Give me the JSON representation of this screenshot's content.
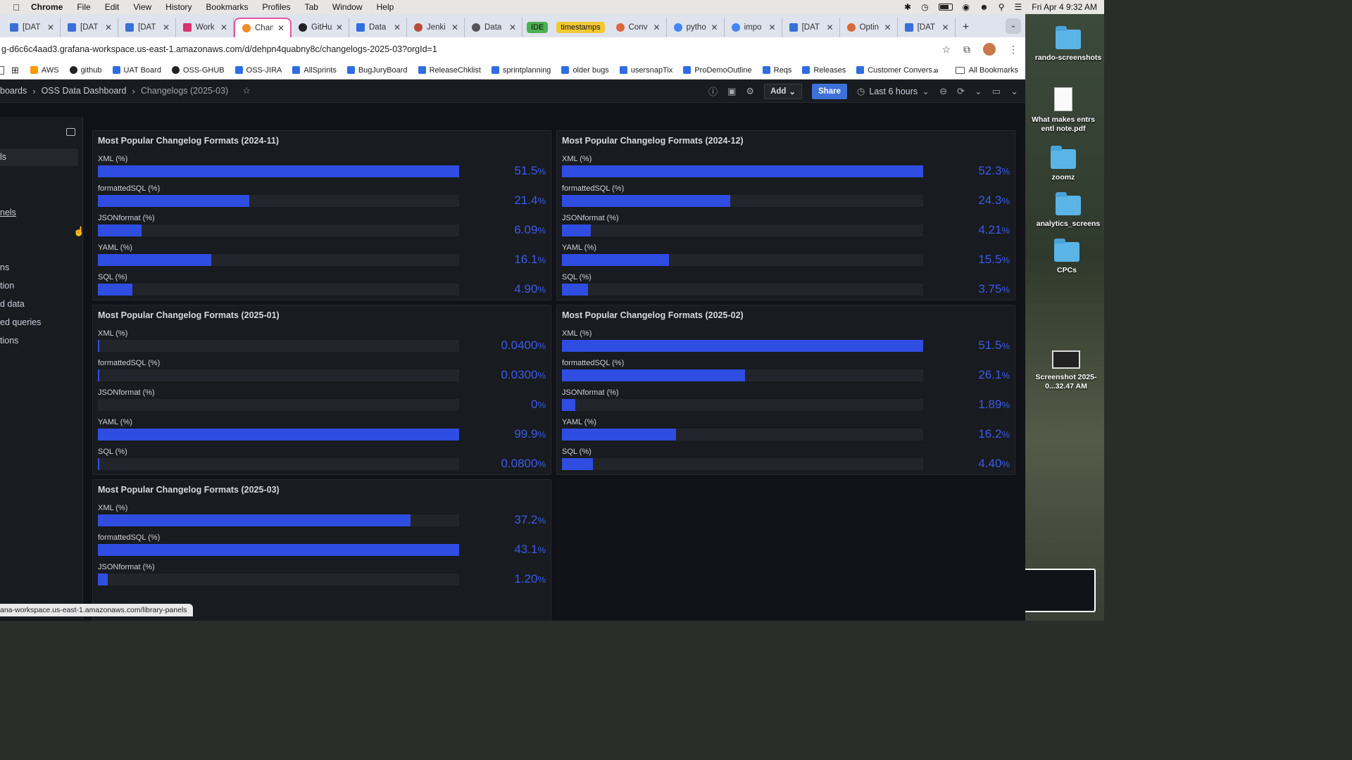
{
  "menubar": {
    "app": "Chrome",
    "items": [
      "File",
      "Edit",
      "View",
      "History",
      "Bookmarks",
      "Profiles",
      "Tab",
      "Window",
      "Help"
    ],
    "clock": "Fri Apr 4  9:32 AM"
  },
  "tabs": [
    {
      "label": "[DAT",
      "color": "#3b6fd8"
    },
    {
      "label": "[DAT",
      "color": "#3b6fd8"
    },
    {
      "label": "[DAT",
      "color": "#3b6fd8"
    },
    {
      "label": "Work",
      "color": "#d6336c"
    },
    {
      "label": "Chan",
      "color": "#f08c2a",
      "active": true
    },
    {
      "label": "GitHu",
      "color": "#222222"
    },
    {
      "label": "Data",
      "color": "#2f6de1"
    },
    {
      "label": "Jenki",
      "color": "#b84a3c"
    },
    {
      "label": "Data",
      "color": "#555555"
    }
  ],
  "tab_pills": [
    {
      "label": "IDE",
      "bg": "#4caf50"
    },
    {
      "label": "timestamps",
      "bg": "#f2c832"
    }
  ],
  "tabs_after": [
    {
      "label": "Conv",
      "color": "#d9693a"
    },
    {
      "label": "pytho",
      "color": "#4285f4"
    },
    {
      "label": "impo",
      "color": "#4285f4"
    },
    {
      "label": "[DAT",
      "color": "#3b6fd8"
    },
    {
      "label": "Optin",
      "color": "#d9693a"
    },
    {
      "label": "[DAT",
      "color": "#3b6fd8"
    }
  ],
  "address": {
    "url": "g-d6c6c4aad3.grafana-workspace.us-east-1.amazonaws.com/d/dehpn4quabny8c/changelogs-2025-03?orgId=1"
  },
  "bookmarks": [
    {
      "label": "AWS",
      "color": "#ff9900"
    },
    {
      "label": "github",
      "color": "#222222"
    },
    {
      "label": "UAT Board",
      "color": "#2f6de1"
    },
    {
      "label": "OSS-GHUB",
      "color": "#222222"
    },
    {
      "label": "OSS-JIRA",
      "color": "#2f6de1"
    },
    {
      "label": "AllSprints",
      "color": "#2f6de1"
    },
    {
      "label": "BugJuryBoard",
      "color": "#2f6de1"
    },
    {
      "label": "ReleaseChklist",
      "color": "#2f6de1"
    },
    {
      "label": "sprintplanning",
      "color": "#2f6de1"
    },
    {
      "label": "older bugs",
      "color": "#2f6de1"
    },
    {
      "label": "usersnapTix",
      "color": "#2f6de1"
    },
    {
      "label": "ProDemoOutline",
      "color": "#2f6de1"
    },
    {
      "label": "Reqs",
      "color": "#2f6de1"
    },
    {
      "label": "Releases",
      "color": "#2f6de1"
    },
    {
      "label": "Customer Convers...",
      "color": "#2f6de1"
    }
  ],
  "all_bookmarks": "All Bookmarks",
  "grafana": {
    "crumb_root": "boards",
    "crumb_dash": "OSS Data Dashboard",
    "crumb_current": "Changelogs (2025-03)",
    "add_label": "Add",
    "share_label": "Share",
    "time_range": "Last 6 hours",
    "sidebar_items": [
      "ls",
      "nels",
      "ns",
      "tion",
      "d data",
      "ed queries",
      "tions"
    ]
  },
  "panels": [
    {
      "title": "Most Popular Changelog Formats (2024-11)",
      "rows": [
        {
          "label": "XML (%)",
          "value": "51.5",
          "fill": 1.0
        },
        {
          "label": "formattedSQL (%)",
          "value": "21.4",
          "fill": 0.419
        },
        {
          "label": "JSONformat (%)",
          "value": "6.09",
          "fill": 0.12
        },
        {
          "label": "YAML (%)",
          "value": "16.1",
          "fill": 0.313
        },
        {
          "label": "SQL (%)",
          "value": "4.90",
          "fill": 0.095
        }
      ]
    },
    {
      "title": "Most Popular Changelog Formats (2024-12)",
      "rows": [
        {
          "label": "XML (%)",
          "value": "52.3",
          "fill": 1.0
        },
        {
          "label": "formattedSQL (%)",
          "value": "24.3",
          "fill": 0.465
        },
        {
          "label": "JSONformat (%)",
          "value": "4.21",
          "fill": 0.08
        },
        {
          "label": "YAML (%)",
          "value": "15.5",
          "fill": 0.296
        },
        {
          "label": "SQL (%)",
          "value": "3.75",
          "fill": 0.072
        }
      ]
    },
    {
      "title": "Most Popular Changelog Formats (2025-01)",
      "rows": [
        {
          "label": "XML (%)",
          "value": "0.0400",
          "fill": 0.004
        },
        {
          "label": "formattedSQL (%)",
          "value": "0.0300",
          "fill": 0.003
        },
        {
          "label": "JSONformat (%)",
          "value": "0",
          "fill": 0
        },
        {
          "label": "YAML (%)",
          "value": "99.9",
          "fill": 1.0
        },
        {
          "label": "SQL (%)",
          "value": "0.0800",
          "fill": 0.004
        }
      ]
    },
    {
      "title": "Most Popular Changelog Formats (2025-02)",
      "rows": [
        {
          "label": "XML (%)",
          "value": "51.5",
          "fill": 1.0
        },
        {
          "label": "formattedSQL (%)",
          "value": "26.1",
          "fill": 0.507
        },
        {
          "label": "JSONformat (%)",
          "value": "1.89",
          "fill": 0.037
        },
        {
          "label": "YAML (%)",
          "value": "16.2",
          "fill": 0.315
        },
        {
          "label": "SQL (%)",
          "value": "4.40",
          "fill": 0.085
        }
      ]
    },
    {
      "title": "Most Popular Changelog Formats (2025-03)",
      "rows": [
        {
          "label": "XML (%)",
          "value": "37.2",
          "fill": 0.865
        },
        {
          "label": "formattedSQL (%)",
          "value": "43.1",
          "fill": 1.0
        },
        {
          "label": "JSONformat (%)",
          "value": "1.20",
          "fill": 0.028
        }
      ]
    }
  ],
  "status_url": "ana-workspace.us-east-1.amazonaws.com/library-panels",
  "desktop": [
    {
      "label": "rando-screenshots",
      "kind": "folder"
    },
    {
      "label": "What makes entrs entl note.pdf",
      "kind": "doc"
    },
    {
      "label": "zoomz",
      "kind": "folder"
    },
    {
      "label": "analytics_screens",
      "kind": "folder"
    },
    {
      "label": "CPCs",
      "kind": "folder"
    },
    {
      "label": "Screenshot 2025-0...32.47 AM",
      "kind": "shot"
    }
  ],
  "colors": {
    "bar": "#2f4de0",
    "value_text": "#3b5bea",
    "panel_bg": "#181b1f"
  }
}
